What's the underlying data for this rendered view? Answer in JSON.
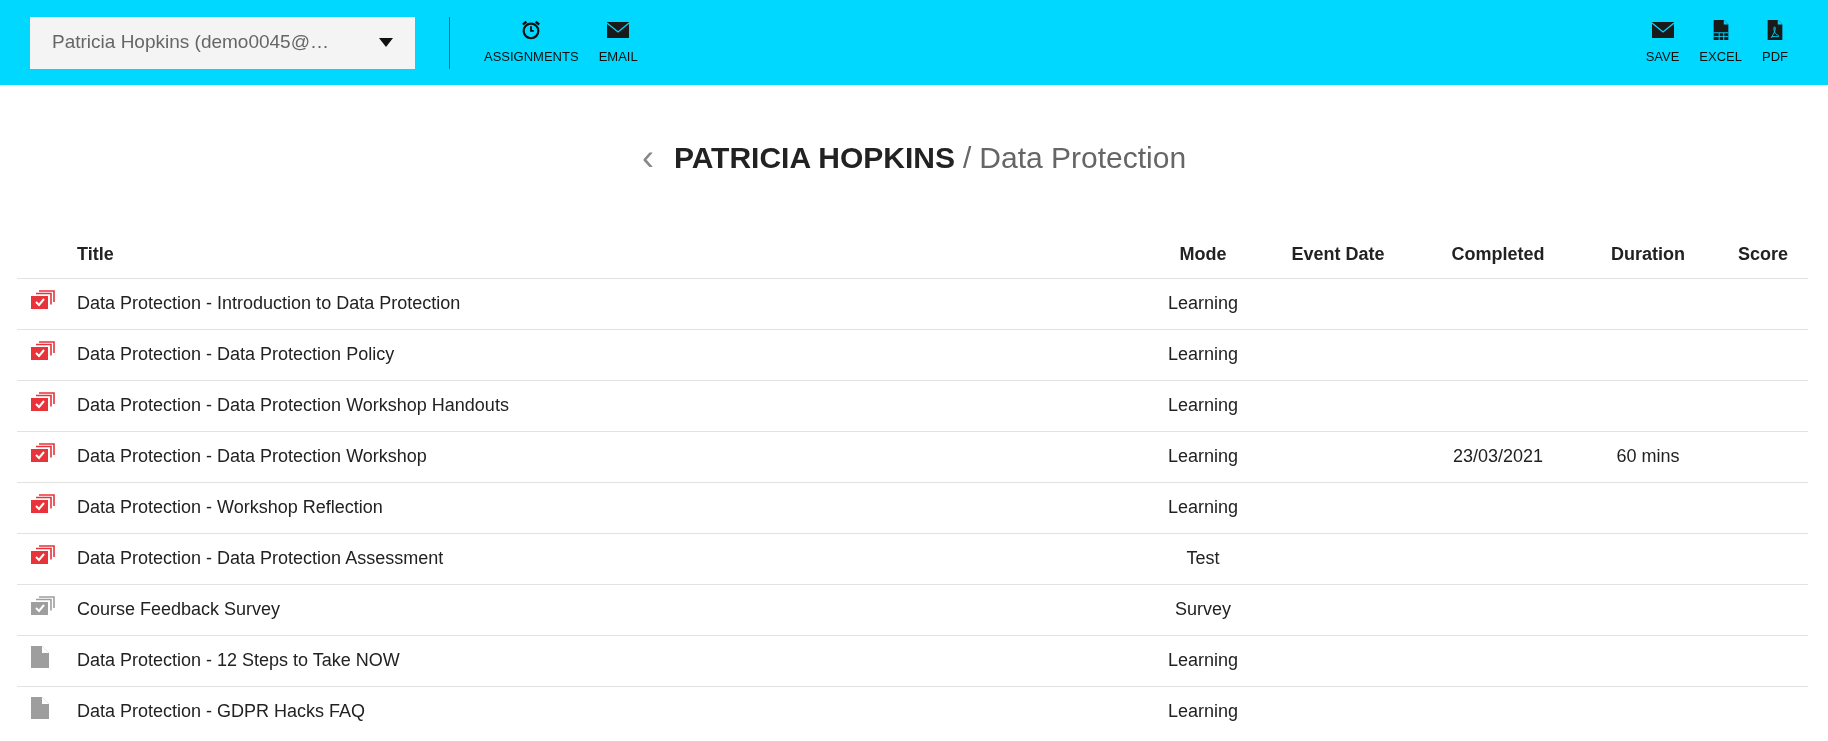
{
  "toolbar": {
    "user_select": {
      "value": "Patricia Hopkins (demo0045@…"
    },
    "left_actions": [
      {
        "kind": "alarm",
        "label": "ASSIGNMENTS"
      },
      {
        "kind": "mail",
        "label": "EMAIL"
      }
    ],
    "right_actions": [
      {
        "kind": "mail",
        "label": "SAVE"
      },
      {
        "kind": "sheet",
        "label": "EXCEL"
      },
      {
        "kind": "pdf",
        "label": "PDF"
      }
    ]
  },
  "heading": {
    "back": "‹",
    "name": "PATRICIA HOPKINS",
    "separator": "/",
    "section": "Data Protection"
  },
  "table": {
    "columns": [
      "Title",
      "Mode",
      "Event Date",
      "Completed",
      "Duration",
      "Score"
    ],
    "rows": [
      {
        "kind": "stack",
        "color": "#e8333a",
        "title": "Data Protection - Introduction to Data Protection",
        "mode": "Learning"
      },
      {
        "kind": "stack",
        "color": "#e8333a",
        "title": "Data Protection - Data Protection Policy",
        "mode": "Learning"
      },
      {
        "kind": "stack",
        "color": "#e8333a",
        "title": "Data Protection - Data Protection Workshop Handouts",
        "mode": "Learning"
      },
      {
        "kind": "stack",
        "color": "#e8333a",
        "title": "Data Protection - Data Protection Workshop",
        "mode": "Learning",
        "completed": "23/03/2021",
        "duration": "60 mins"
      },
      {
        "kind": "stack",
        "color": "#e8333a",
        "title": "Data Protection - Workshop Reflection",
        "mode": "Learning"
      },
      {
        "kind": "stack",
        "color": "#e8333a",
        "title": "Data Protection - Data Protection Assessment",
        "mode": "Test"
      },
      {
        "kind": "stack",
        "color": "#9e9e9e",
        "title": "Course Feedback Survey",
        "mode": "Survey"
      },
      {
        "kind": "file",
        "color": "#9e9e9e",
        "title": "Data Protection - 12 Steps to Take NOW",
        "mode": "Learning"
      },
      {
        "kind": "file",
        "color": "#9e9e9e",
        "title": "Data Protection - GDPR Hacks FAQ",
        "mode": "Learning"
      }
    ]
  }
}
